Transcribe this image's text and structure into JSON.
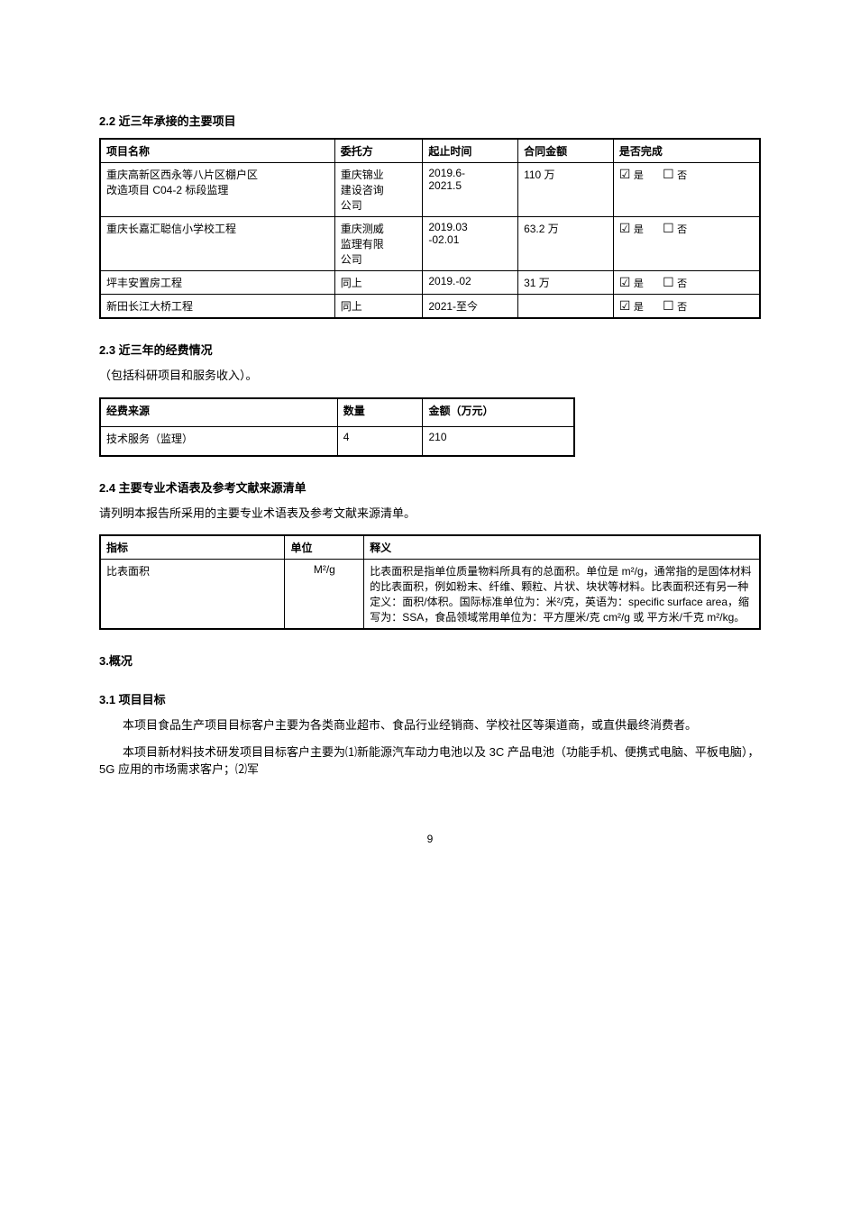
{
  "section2_2": {
    "title": "2.2  近三年承接的主要项目",
    "table": {
      "headers": [
        "项目名称",
        "委托方",
        "起止时间",
        "合同金额",
        "是否完成"
      ],
      "rows": [
        {
          "name": "重庆高新区西永等八片区棚户区\n改造项目 C04-2 标段监理",
          "client": "重庆锦业\n建设咨询\n公司",
          "period": "2019.6-\n2021.5",
          "amount": "110 万",
          "done_yes": true,
          "done_no": false
        },
        {
          "name": "重庆长嘉汇聪信小学校工程",
          "client": "重庆测威\n监理有限\n公司",
          "period": "2019.03\n-02.01",
          "amount": "63.2 万",
          "done_yes": true,
          "done_no": false
        },
        {
          "name": "坪丰安置房工程",
          "client": "同上",
          "period": "2019.-02",
          "amount": "31 万",
          "done_yes": true,
          "done_no": false
        },
        {
          "name": "新田长江大桥工程",
          "client": "同上",
          "period": "2021-至今",
          "amount": "",
          "done_yes": true,
          "done_no": false
        }
      ],
      "yes_label": "是",
      "no_label": "否"
    }
  },
  "section2_3": {
    "title": "2.3  近三年的经费情况",
    "lead": "（包括科研项目和服务收入）。",
    "table": {
      "headers": [
        "经费来源",
        "数量",
        "金额（万元）"
      ],
      "rows": [
        {
          "source": "技术服务（监理）",
          "count": "4",
          "amount": "210"
        }
      ]
    }
  },
  "section2_4": {
    "title": "2.4  主要专业术语表及参考文献来源清单",
    "lead": "请列明本报告所采用的主要专业术语表及参考文献来源清单。",
    "table": {
      "headers": [
        "指标",
        "单位",
        "释义"
      ],
      "rows": [
        {
          "indicator": "比表面积",
          "unit": "M²/g",
          "definition": "比表面积是指单位质量物料所具有的总面积。单位是 m²/g，通常指的是固体材料的比表面积，例如粉末、纤维、颗粒、片状、块状等材料。比表面积还有另一种定义：面积/体积。国际标准单位为：米²/克，英语为：specific surface area，缩写为：SSA，食品领域常用单位为：平方厘米/克 cm²/g 或 平方米/千克 m²/kg。"
        }
      ]
    }
  },
  "section3": {
    "title": "3.概况",
    "subtitle": "3.1  项目目标",
    "paras": [
      "本项目食品生产项目目标客户主要为各类商业超市、食品行业经销商、学校社区等渠道商，或直供最终消费者。",
      "本项目新材料技术研发项目目标客户主要为⑴新能源汽车动力电池以及 3C 产品电池（功能手机、便携式电脑、平板电脑），5G 应用的市场需求客户；⑵军"
    ]
  },
  "page_number": "9"
}
